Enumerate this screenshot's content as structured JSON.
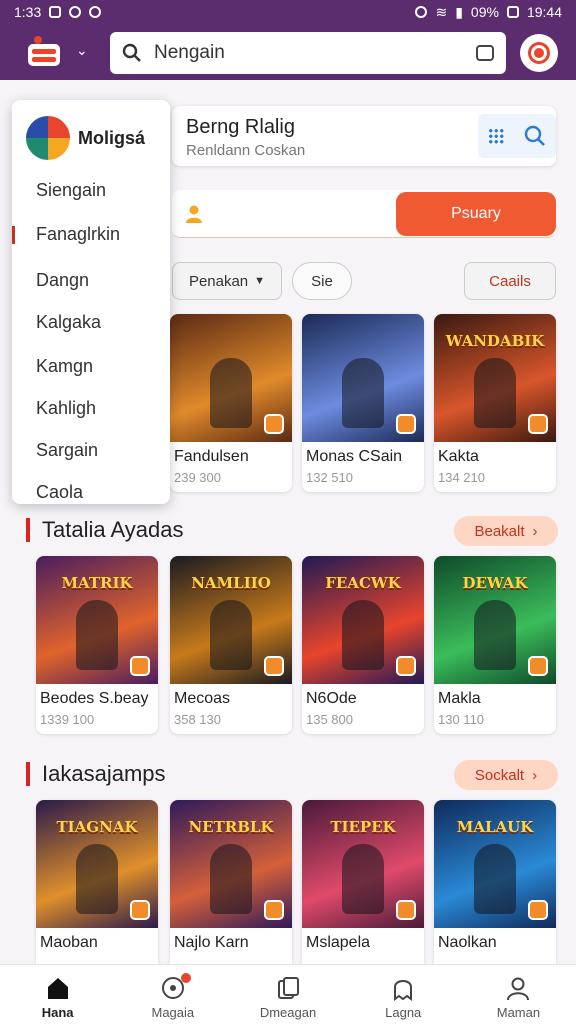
{
  "status_bar": {
    "time": "1:33",
    "battery": "09%",
    "clock": "19:44"
  },
  "app_bar": {
    "search_text": "Nengain"
  },
  "panel": {
    "title": "Berng Rlalig",
    "subtitle": "Renldann Coskan"
  },
  "promo": {
    "button_label": "Psuary"
  },
  "filters": {
    "sort_label": "Penakan",
    "chip_label": "Sie",
    "category_label": "Caails"
  },
  "dropdown": {
    "brand": "Moligsá",
    "items": [
      {
        "label": "Siengain"
      },
      {
        "label": "Fanaglrkin"
      },
      {
        "label": "Dangn"
      },
      {
        "label": "Kalgaka"
      },
      {
        "label": "Kamgn"
      },
      {
        "label": "Kahligh"
      },
      {
        "label": "Sargain"
      },
      {
        "label": "Caola"
      }
    ]
  },
  "row1": [
    {
      "name": "Fandulsen",
      "count": "239 300",
      "art": "",
      "colors": [
        "#5a2a14",
        "#e08a2b"
      ]
    },
    {
      "name": "Monas CSain",
      "count": "132 510",
      "art": "",
      "colors": [
        "#1b2a55",
        "#6d8ce0"
      ]
    },
    {
      "name": "Kakta",
      "count": "134 210",
      "art": "WANDABIK",
      "colors": [
        "#3a1a10",
        "#d9562b"
      ]
    }
  ],
  "sections": [
    {
      "title": "Tatalia Ayadas",
      "see_label": "Beakalt",
      "cards": [
        {
          "name": "Beodes S.beay",
          "count": "1339 100",
          "art": "MATRIK",
          "colors": [
            "#4a1d5e",
            "#e0642b"
          ]
        },
        {
          "name": "Mecoas",
          "count": "358 130",
          "art": "NAMLIIO",
          "colors": [
            "#1a1a22",
            "#c77a1a"
          ]
        },
        {
          "name": "N6Ode",
          "count": "135 800",
          "art": "FEACWK",
          "colors": [
            "#201a55",
            "#e8452c"
          ]
        },
        {
          "name": "Makla",
          "count": "130 110",
          "art": "DEWAK",
          "colors": [
            "#0f4a2a",
            "#3bbd5a"
          ]
        }
      ]
    },
    {
      "title": "Iakasajamps",
      "see_label": "Sockalt",
      "cards": [
        {
          "name": "Maoban",
          "count": "",
          "art": "TIAGNAK",
          "colors": [
            "#2a1a4a",
            "#e0902b"
          ]
        },
        {
          "name": "Najlo Karn",
          "count": "",
          "art": "NETRBLK",
          "colors": [
            "#301a5a",
            "#d4603a"
          ]
        },
        {
          "name": "Mslapela",
          "count": "",
          "art": "TIEPEK",
          "colors": [
            "#4a1a3a",
            "#e04a6a"
          ]
        },
        {
          "name": "Naolkan",
          "count": "",
          "art": "MALAUK",
          "colors": [
            "#102a5a",
            "#2a8ad6"
          ]
        }
      ]
    }
  ],
  "bottom_nav": [
    {
      "label": "Hana",
      "icon": "home-icon",
      "active": true
    },
    {
      "label": "Magaia",
      "icon": "chat-icon",
      "active": false
    },
    {
      "label": "Dmeagan",
      "icon": "library-icon",
      "active": false
    },
    {
      "label": "Lagna",
      "icon": "ghost-icon",
      "active": false
    },
    {
      "label": "Maman",
      "icon": "profile-icon",
      "active": false
    }
  ],
  "colors": {
    "app_bar": "#5b2d6e",
    "accent": "#ef5a32",
    "see_button": "#fdd6c4"
  }
}
